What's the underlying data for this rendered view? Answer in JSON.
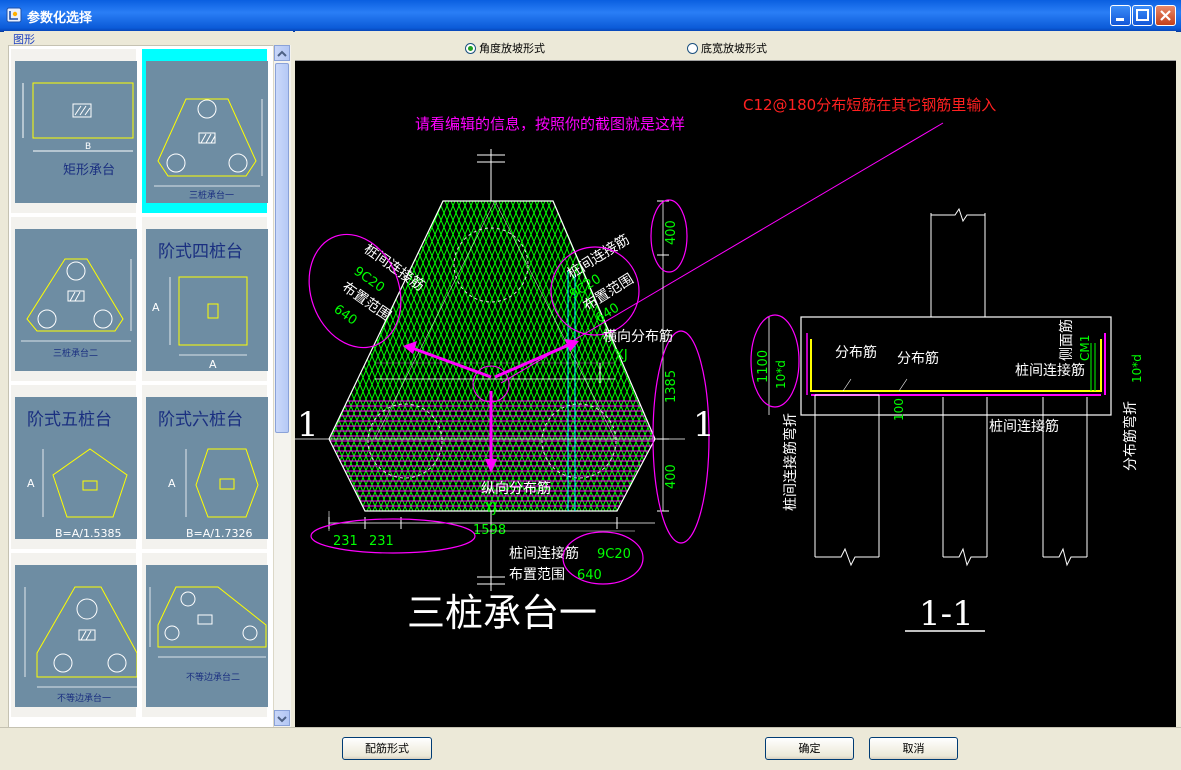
{
  "window": {
    "title": "参数化选择"
  },
  "left_panel": {
    "group_label": "图形",
    "thumbnails": [
      {
        "name": "rect-cap",
        "label": "矩形承台",
        "dim": "B"
      },
      {
        "name": "three-pile-cap-1",
        "label": "三桩承台一",
        "selected": true
      },
      {
        "name": "three-pile-cap-2",
        "label": "三桩承台二"
      },
      {
        "name": "stepped-four-pile",
        "label": "阶式四桩台",
        "dim": "A"
      },
      {
        "name": "stepped-five-pile",
        "label": "阶式五桩台",
        "dim": "A",
        "formula": "B=A/1.5385"
      },
      {
        "name": "stepped-six-pile",
        "label": "阶式六桩台",
        "dim": "A",
        "formula": "B=A/1.7326"
      },
      {
        "name": "unequal-edge-1",
        "label": "不等边承台一"
      },
      {
        "name": "unequal-edge-2",
        "label": "不等边承台二"
      }
    ]
  },
  "options": {
    "angle_slope": "角度放坡形式",
    "base_width_slope": "底宽放坡形式",
    "selected": "angle_slope"
  },
  "drawing": {
    "annotation_red": "C12@180分布短筋在其它钢筋里输入",
    "annotation_magenta": "请看编辑的信息，按照你的截图就是这样",
    "plan_title": "三桩承台一",
    "section_title": "1-1",
    "section_mark": "1",
    "left_tie": {
      "label1": "桩间连接筋",
      "value": "9C20",
      "label2": "布置范围",
      "range": "640"
    },
    "right_tie": {
      "label1": "桩间连接筋",
      "value": "9C20",
      "label2": "布置范围",
      "range": "640"
    },
    "bottom_tie": {
      "label1": "桩间连接筋",
      "value": "9C20",
      "label2": "布置范围",
      "range": "640"
    },
    "horizontal_dist": "横向分布筋",
    "xj": "XJ",
    "longitudinal_dist": "纵向分布筋",
    "yj": "YJ",
    "dim_400_top": "400",
    "dim_1385": "1385",
    "dim_400_bottom": "400",
    "dim_231a": "231",
    "dim_231b": "231",
    "dim_1598": "1598",
    "section": {
      "dist_bar_1": "分布筋",
      "dist_bar_2": "分布筋",
      "side_bar": "侧面筋",
      "cm1": "CM1",
      "tie_bar": "桩间连接筋",
      "tie_bar_2": "桩间连接筋",
      "dim_1100": "1100",
      "ten_d_left": "10*d",
      "ten_d_right": "10*d",
      "dim_100": "100",
      "tie_bend": "桩间连接筋弯折",
      "dist_bend": "分布筋弯折"
    }
  },
  "buttons": {
    "rebar_form": "配筋形式",
    "ok": "确定",
    "cancel": "取消"
  },
  "colors": {
    "green": "#00ff00",
    "magenta": "#ff00ff",
    "yellow": "#ffff00",
    "red": "#ff2020",
    "cyan": "#00ffff"
  }
}
